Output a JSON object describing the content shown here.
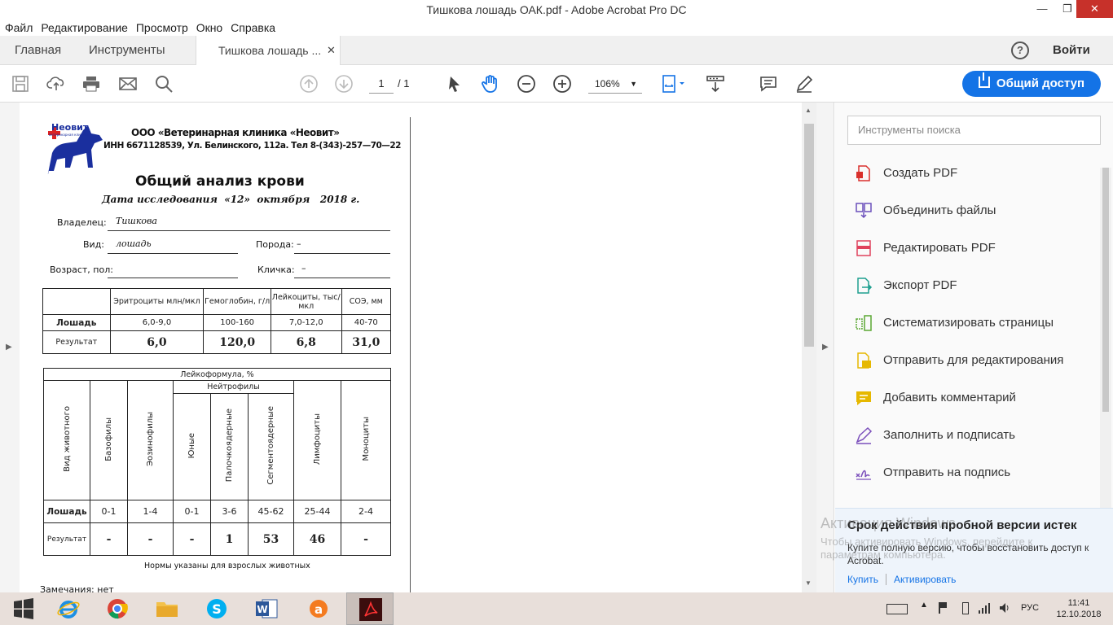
{
  "window": {
    "title": "Тишкова лошадь ОАК.pdf - Adobe Acrobat Pro DC"
  },
  "menu": [
    "Файл",
    "Редактирование",
    "Просмотр",
    "Окно",
    "Справка"
  ],
  "tabs": {
    "home": "Главная",
    "tools": "Инструменты",
    "document": "Тишкова лошадь ...",
    "signin": "Войти"
  },
  "toolbar": {
    "page_current": "1",
    "page_total": "/ 1",
    "zoom": "106%",
    "share_label": "Общий доступ"
  },
  "right_pane": {
    "search_placeholder": "Инструменты поиска",
    "tools": [
      {
        "label": "Создать PDF",
        "icon": "create-pdf-icon",
        "color": "#d9302c"
      },
      {
        "label": "Объединить файлы",
        "icon": "combine-files-icon",
        "color": "#6b4fbb"
      },
      {
        "label": "Редактировать PDF",
        "icon": "edit-pdf-icon",
        "color": "#e0425d"
      },
      {
        "label": "Экспорт PDF",
        "icon": "export-pdf-icon",
        "color": "#1e9f8f"
      },
      {
        "label": "Систематизировать страницы",
        "icon": "organize-pages-icon",
        "color": "#5aa832"
      },
      {
        "label": "Отправить для редактирования",
        "icon": "send-review-icon",
        "color": "#e6b800"
      },
      {
        "label": "Добавить комментарий",
        "icon": "comment-icon",
        "color": "#e6b800"
      },
      {
        "label": "Заполнить и подписать",
        "icon": "fill-sign-icon",
        "color": "#7b4fbb"
      },
      {
        "label": "Отправить на подпись",
        "icon": "send-sign-icon",
        "color": "#7b4fbb"
      }
    ],
    "trial": {
      "title": "Срок действия пробной версии истек",
      "text": "Купите полную версию, чтобы восстановить доступ к Acrobat.",
      "buy": "Купить",
      "activate": "Активировать"
    }
  },
  "watermark": {
    "line1": "Активация Windows",
    "line2": "Чтобы активировать Windows, перейдите к параметрам компьютера."
  },
  "document": {
    "clinic_logo": "Неовит",
    "clinic_logo_sub": "ветеринарная клиника",
    "clinic_name": "ООО «Ветеринарная клиника «Неовит»",
    "clinic_info": "ИНН 6671128539, Ул. Белинского, 112а. Тел 8-(343)-257—70—22",
    "title": "Общий анализ крови",
    "date_prefix": "Дата исследования",
    "date_day": "«12»",
    "date_month": "октября",
    "date_year": "2018 г.",
    "owner_label": "Владелец:",
    "owner_value": "Тишкова",
    "species_label": "Вид:",
    "species_value": "лошадь",
    "breed_label": "Порода:",
    "breed_value": "–",
    "age_label": "Возраст, пол:",
    "name_label": "Кличка:",
    "name_value": "–",
    "blood_table": {
      "headers": [
        "",
        "Эритроциты млн/мкл",
        "Гемоглобин, г/л",
        "Лейкоциты, тыс/мкл",
        "СОЭ, мм"
      ],
      "norm_label": "Лошадь",
      "norms": [
        "6,0-9,0",
        "100-160",
        "7,0-12,0",
        "40-70"
      ],
      "result_label": "Результат",
      "results": [
        "6,0",
        "120,0",
        "6,8",
        "31,0"
      ]
    },
    "leuko_table": {
      "title": "Лейкоформула, %",
      "neutro": "Нейтрофилы",
      "columns": [
        "Вид животного",
        "Базофилы",
        "Эозинофилы",
        "Юные",
        "Палочкоядерные",
        "Сегментоядерные",
        "Лимфоциты",
        "Моноциты"
      ],
      "norm_label": "Лошадь",
      "norms": [
        "0-1",
        "1-4",
        "0-1",
        "3-6",
        "45-62",
        "25-44",
        "2-4"
      ],
      "result_label": "Результат",
      "results": [
        "-",
        "-",
        "-",
        "1",
        "53",
        "46",
        "-"
      ]
    },
    "footnote": "Нормы указаны для взрослых животных",
    "remarks": "Замечания: нет"
  },
  "taskbar": {
    "lang": "РУС",
    "time": "11:41",
    "date": "12.10.2018"
  }
}
